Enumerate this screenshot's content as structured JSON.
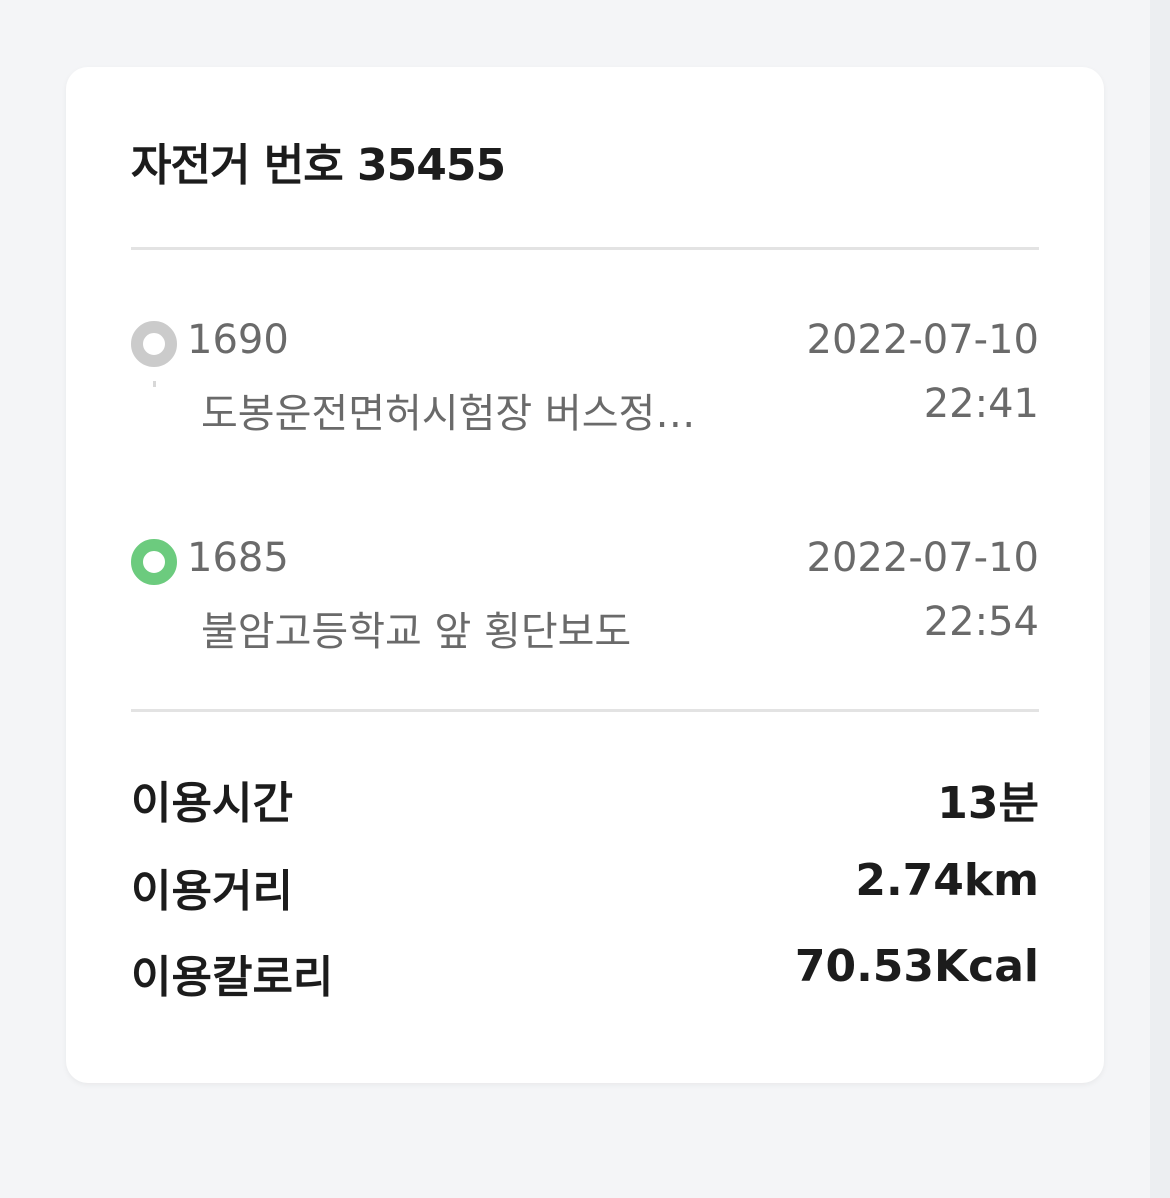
{
  "card": {
    "title": "자전거 번호 35455"
  },
  "route": {
    "start": {
      "station_id": "1690",
      "station_name": "도봉운전면허시험장 버스정…",
      "date": "2022-07-10",
      "time": "22:41",
      "marker_color": "#cbcbcb"
    },
    "end": {
      "station_id": "1685",
      "station_name": "불암고등학교 앞 횡단보도",
      "date": "2022-07-10",
      "time": "22:54",
      "marker_color": "#6ccb7e"
    }
  },
  "stats": [
    {
      "label": "이용시간",
      "value": "13분"
    },
    {
      "label": "이용거리",
      "value": "2.74km"
    },
    {
      "label": "이용칼로리",
      "value": "70.53Kcal"
    }
  ]
}
